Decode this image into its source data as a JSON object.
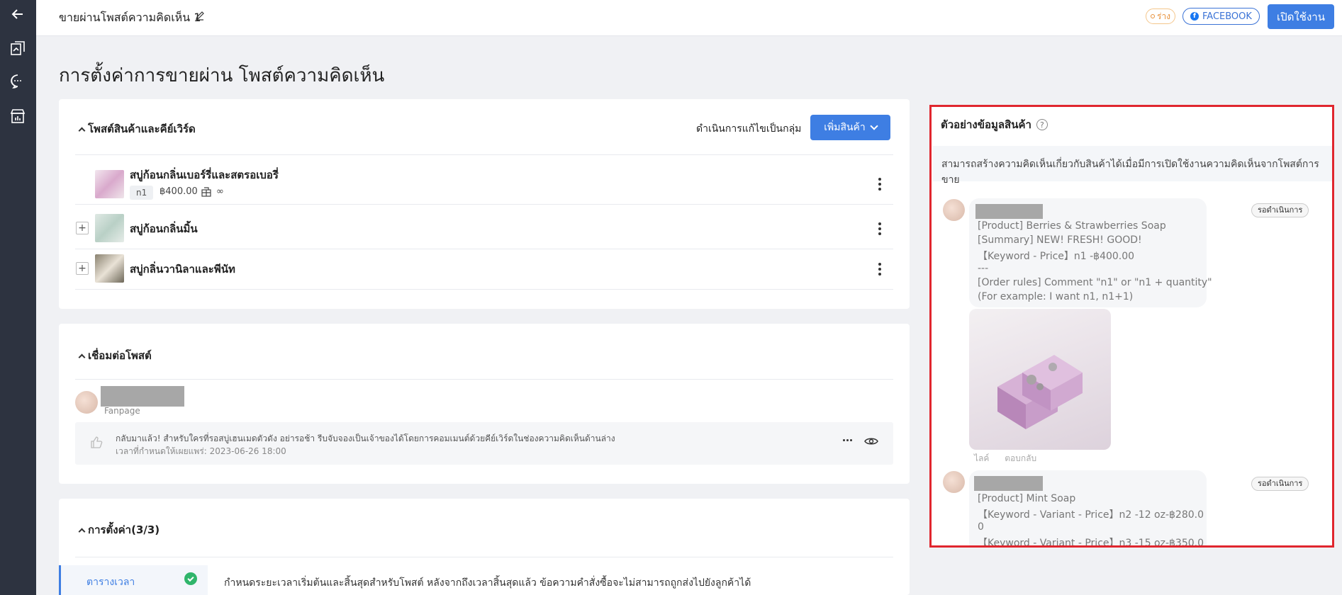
{
  "topbar": {
    "title": "ขายผ่านโพสต์ความคิดเห็น 1",
    "draft_badge": "ร่าง",
    "facebook_badge": "FACEBOOK",
    "enable_button": "เปิดใช้งาน"
  },
  "page": {
    "title": "การตั้งค่าการขายผ่าน โพสต์ความคิดเห็น"
  },
  "products_card": {
    "title": "โพสต์สินค้าและคีย์เวิร์ด",
    "bulk_edit": "ดำเนินการแก้ไขเป็นกลุ่ม",
    "add_product": "เพิ่มสินค้า",
    "items": [
      {
        "name": "สบู่ก้อนกลิ่นเบอร์รี่และสตรอเบอรี่",
        "keyword": "n1",
        "price": "฿400.00",
        "stock": "∞"
      },
      {
        "name": "สบู่ก้อนกลิ่นมิ้น"
      },
      {
        "name": "สบู่กลิ่นวานิลาและพีนัท"
      }
    ]
  },
  "connect_card": {
    "title": "เชื่อมต่อโพสต์",
    "page_type": "Fanpage",
    "post_text": "กลับมาแล้ว! สำหรับใครที่รอสบู่เฮนเมดตัวดัง อย่ารอช้า รีบจับจองเป็นเจ้าของได้โดยการคอมเมนต์ด้วยคีย์เวิร์ดในช่องความคิดเห็นด้านล่าง",
    "post_time": "เวลาที่กำหนดให้เผยแพร่: 2023-06-26 18:00"
  },
  "settings_card": {
    "title": "การตั้งค่า(3/3)",
    "tab_schedule": "ตารางเวลา",
    "schedule_desc": "กำหนดระยะเวลาเริ่มต้นและสิ้นสุดสำหรับโพสต์ หลังจากถึงเวลาสิ้นสุดแล้ว ข้อความคำสั่งซื้อจะไม่สามารถถูกส่งไปยังลูกค้าได้"
  },
  "preview": {
    "title": "ตัวอย่างข้อมูลสินค้า",
    "note": "สามารถสร้างความคิดเห็นเกี่ยวกับสินค้าได้เมื่อมีการเปิดใช้งานความคิดเห็นจากโพสต์การขาย",
    "pending_label": "รอดำเนินการ",
    "like": "ไลค์",
    "reply": "ตอบกลับ",
    "comment1": [
      "[Product] Berries & Strawberries Soap",
      "[Summary] NEW! FRESH! GOOD!",
      "【Keyword - Price】n1 -฿400.00",
      "---",
      "[Order rules] Comment \"n1\" or \"n1 + quantity\"",
      "(For example: I want n1, n1+1)"
    ],
    "comment2": [
      "[Product] Mint Soap",
      "【Keyword - Variant - Price】n2 -12 oz-฿280.0",
      "0",
      "【Keyword - Variant - Price】n3 -15 oz-฿350.0"
    ]
  },
  "colors": {
    "primary": "#3e7ee3",
    "sidebar": "#2d3340",
    "highlight": "#e0262e",
    "success": "#30b56b"
  }
}
